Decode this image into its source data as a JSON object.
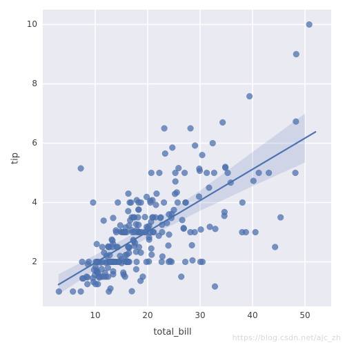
{
  "chart_data": {
    "type": "scatter",
    "xlabel": "total_bill",
    "ylabel": "tip",
    "xlim": [
      0,
      55
    ],
    "ylim": [
      0.5,
      10.5
    ],
    "xticks": [
      10,
      20,
      30,
      40,
      50
    ],
    "yticks": [
      2,
      4,
      6,
      8,
      10
    ],
    "regression": {
      "slope": 0.105,
      "intercept": 0.92
    },
    "ci_band": [
      {
        "x": 3,
        "lo": 0.9,
        "hi": 1.58
      },
      {
        "x": 10,
        "lo": 1.72,
        "hi": 2.23
      },
      {
        "x": 20,
        "lo": 2.82,
        "hi": 3.22
      },
      {
        "x": 30,
        "lo": 3.72,
        "hi": 4.4
      },
      {
        "x": 40,
        "lo": 4.55,
        "hi": 5.7
      },
      {
        "x": 50,
        "lo": 5.35,
        "hi": 7.0
      }
    ],
    "points": [
      [
        16.99,
        1.01
      ],
      [
        10.34,
        1.66
      ],
      [
        21.01,
        3.5
      ],
      [
        23.68,
        3.31
      ],
      [
        24.59,
        3.61
      ],
      [
        25.29,
        4.71
      ],
      [
        8.77,
        2.0
      ],
      [
        26.88,
        3.12
      ],
      [
        15.04,
        1.96
      ],
      [
        14.78,
        3.23
      ],
      [
        10.27,
        1.71
      ],
      [
        35.26,
        5.0
      ],
      [
        15.42,
        1.57
      ],
      [
        18.43,
        3.0
      ],
      [
        14.83,
        3.02
      ],
      [
        21.58,
        3.92
      ],
      [
        10.33,
        1.67
      ],
      [
        16.29,
        3.71
      ],
      [
        16.97,
        3.5
      ],
      [
        20.65,
        3.35
      ],
      [
        17.92,
        4.08
      ],
      [
        20.29,
        2.75
      ],
      [
        15.77,
        2.23
      ],
      [
        39.42,
        7.58
      ],
      [
        19.82,
        3.18
      ],
      [
        17.81,
        2.34
      ],
      [
        13.37,
        2.0
      ],
      [
        12.69,
        2.0
      ],
      [
        21.7,
        4.3
      ],
      [
        19.65,
        3.0
      ],
      [
        9.55,
        1.45
      ],
      [
        18.35,
        2.5
      ],
      [
        15.06,
        3.0
      ],
      [
        20.69,
        2.45
      ],
      [
        17.78,
        3.27
      ],
      [
        24.06,
        3.6
      ],
      [
        16.31,
        2.0
      ],
      [
        16.93,
        3.07
      ],
      [
        18.69,
        2.31
      ],
      [
        31.27,
        5.0
      ],
      [
        16.04,
        2.24
      ],
      [
        17.46,
        2.54
      ],
      [
        13.94,
        3.06
      ],
      [
        9.68,
        1.32
      ],
      [
        30.4,
        5.6
      ],
      [
        18.29,
        3.0
      ],
      [
        22.23,
        5.0
      ],
      [
        32.4,
        6.0
      ],
      [
        28.55,
        2.05
      ],
      [
        18.04,
        3.0
      ],
      [
        12.54,
        2.5
      ],
      [
        10.29,
        2.6
      ],
      [
        34.81,
        5.2
      ],
      [
        9.94,
        1.56
      ],
      [
        25.56,
        4.34
      ],
      [
        19.49,
        3.51
      ],
      [
        38.01,
        3.0
      ],
      [
        26.41,
        1.5
      ],
      [
        11.24,
        1.76
      ],
      [
        48.27,
        6.73
      ],
      [
        20.29,
        3.21
      ],
      [
        13.81,
        2.0
      ],
      [
        11.02,
        1.98
      ],
      [
        18.29,
        3.76
      ],
      [
        17.59,
        2.64
      ],
      [
        20.08,
        3.15
      ],
      [
        16.45,
        2.47
      ],
      [
        3.07,
        1.0
      ],
      [
        20.23,
        2.01
      ],
      [
        15.01,
        2.09
      ],
      [
        12.02,
        1.97
      ],
      [
        17.07,
        3.0
      ],
      [
        26.86,
        3.14
      ],
      [
        25.28,
        5.0
      ],
      [
        14.73,
        2.2
      ],
      [
        10.51,
        1.25
      ],
      [
        17.92,
        3.08
      ],
      [
        27.2,
        4.0
      ],
      [
        22.76,
        3.0
      ],
      [
        17.29,
        2.71
      ],
      [
        19.44,
        3.0
      ],
      [
        16.66,
        3.4
      ],
      [
        10.07,
        1.83
      ],
      [
        32.68,
        5.0
      ],
      [
        15.98,
        2.03
      ],
      [
        34.83,
        5.17
      ],
      [
        13.03,
        2.0
      ],
      [
        18.28,
        4.0
      ],
      [
        24.71,
        5.85
      ],
      [
        21.16,
        3.0
      ],
      [
        28.97,
        3.0
      ],
      [
        22.49,
        3.5
      ],
      [
        5.75,
        1.0
      ],
      [
        16.32,
        4.3
      ],
      [
        22.75,
        3.25
      ],
      [
        40.17,
        4.73
      ],
      [
        27.28,
        4.0
      ],
      [
        12.03,
        1.5
      ],
      [
        21.01,
        3.0
      ],
      [
        12.46,
        1.5
      ],
      [
        11.35,
        2.5
      ],
      [
        15.38,
        3.0
      ],
      [
        44.3,
        2.5
      ],
      [
        22.42,
        3.48
      ],
      [
        20.92,
        4.08
      ],
      [
        15.36,
        1.64
      ],
      [
        20.49,
        4.06
      ],
      [
        25.21,
        4.29
      ],
      [
        18.24,
        3.76
      ],
      [
        14.31,
        4.0
      ],
      [
        14.0,
        3.0
      ],
      [
        7.25,
        1.0
      ],
      [
        38.07,
        4.0
      ],
      [
        23.95,
        2.55
      ],
      [
        25.71,
        4.0
      ],
      [
        17.31,
        3.5
      ],
      [
        29.93,
        5.07
      ],
      [
        10.65,
        1.5
      ],
      [
        12.43,
        1.8
      ],
      [
        24.08,
        2.92
      ],
      [
        11.69,
        2.31
      ],
      [
        13.42,
        1.68
      ],
      [
        14.26,
        2.5
      ],
      [
        15.95,
        2.0
      ],
      [
        12.48,
        2.52
      ],
      [
        29.8,
        4.2
      ],
      [
        8.52,
        1.48
      ],
      [
        14.52,
        2.0
      ],
      [
        11.38,
        2.0
      ],
      [
        22.82,
        2.18
      ],
      [
        19.08,
        1.5
      ],
      [
        20.27,
        2.83
      ],
      [
        11.17,
        1.5
      ],
      [
        12.26,
        2.0
      ],
      [
        18.26,
        3.25
      ],
      [
        8.51,
        1.25
      ],
      [
        10.33,
        2.0
      ],
      [
        14.15,
        2.0
      ],
      [
        16.0,
        2.0
      ],
      [
        13.16,
        2.75
      ],
      [
        17.47,
        3.5
      ],
      [
        34.3,
        6.7
      ],
      [
        41.19,
        5.0
      ],
      [
        27.05,
        5.0
      ],
      [
        16.43,
        2.3
      ],
      [
        8.35,
        1.5
      ],
      [
        18.64,
        1.36
      ],
      [
        11.87,
        1.63
      ],
      [
        9.78,
        1.73
      ],
      [
        7.51,
        2.0
      ],
      [
        14.07,
        2.5
      ],
      [
        13.13,
        2.0
      ],
      [
        17.26,
        2.74
      ],
      [
        24.55,
        2.0
      ],
      [
        19.77,
        2.0
      ],
      [
        29.85,
        5.14
      ],
      [
        48.17,
        5.0
      ],
      [
        25.0,
        3.75
      ],
      [
        13.39,
        2.61
      ],
      [
        16.49,
        2.0
      ],
      [
        21.5,
        3.5
      ],
      [
        12.66,
        2.5
      ],
      [
        16.21,
        2.0
      ],
      [
        13.81,
        2.0
      ],
      [
        17.51,
        3.0
      ],
      [
        24.52,
        3.48
      ],
      [
        20.76,
        2.24
      ],
      [
        31.71,
        4.5
      ],
      [
        10.59,
        1.61
      ],
      [
        10.63,
        2.0
      ],
      [
        50.81,
        10.0
      ],
      [
        15.81,
        3.16
      ],
      [
        7.25,
        5.15
      ],
      [
        31.85,
        3.18
      ],
      [
        16.82,
        4.0
      ],
      [
        32.9,
        3.11
      ],
      [
        17.89,
        2.0
      ],
      [
        14.48,
        2.0
      ],
      [
        9.6,
        4.0
      ],
      [
        34.63,
        3.55
      ],
      [
        34.65,
        3.68
      ],
      [
        23.33,
        5.65
      ],
      [
        45.35,
        3.5
      ],
      [
        23.17,
        6.5
      ],
      [
        40.55,
        3.0
      ],
      [
        20.69,
        5.0
      ],
      [
        20.9,
        3.5
      ],
      [
        30.46,
        2.0
      ],
      [
        18.15,
        3.5
      ],
      [
        23.1,
        4.0
      ],
      [
        15.69,
        1.5
      ],
      [
        19.81,
        4.19
      ],
      [
        28.44,
        2.56
      ],
      [
        15.48,
        2.02
      ],
      [
        16.58,
        4.0
      ],
      [
        7.56,
        1.44
      ],
      [
        10.34,
        2.0
      ],
      [
        43.11,
        5.0
      ],
      [
        13.0,
        2.0
      ],
      [
        13.51,
        2.0
      ],
      [
        18.71,
        4.0
      ],
      [
        12.74,
        2.01
      ],
      [
        13.0,
        2.0
      ],
      [
        16.4,
        2.5
      ],
      [
        20.53,
        4.0
      ],
      [
        16.47,
        3.23
      ],
      [
        26.59,
        3.41
      ],
      [
        38.73,
        3.0
      ],
      [
        24.27,
        2.03
      ],
      [
        12.76,
        2.23
      ],
      [
        30.06,
        2.0
      ],
      [
        25.89,
        5.16
      ],
      [
        48.33,
        9.0
      ],
      [
        13.27,
        2.5
      ],
      [
        28.17,
        6.5
      ],
      [
        12.9,
        1.1
      ],
      [
        28.15,
        3.0
      ],
      [
        11.59,
        1.5
      ],
      [
        7.74,
        1.44
      ],
      [
        30.14,
        3.09
      ],
      [
        12.16,
        2.2
      ],
      [
        13.42,
        3.48
      ],
      [
        8.58,
        1.92
      ],
      [
        15.98,
        3.0
      ],
      [
        13.42,
        1.58
      ],
      [
        16.27,
        2.5
      ],
      [
        10.09,
        2.0
      ],
      [
        20.45,
        3.0
      ],
      [
        13.28,
        2.72
      ],
      [
        22.12,
        2.88
      ],
      [
        24.01,
        2.0
      ],
      [
        15.69,
        3.0
      ],
      [
        11.61,
        3.39
      ],
      [
        10.77,
        1.47
      ],
      [
        15.53,
        3.0
      ],
      [
        10.07,
        1.25
      ],
      [
        12.6,
        1.0
      ],
      [
        32.83,
        1.17
      ],
      [
        35.83,
        4.67
      ],
      [
        29.03,
        5.92
      ],
      [
        27.18,
        2.0
      ],
      [
        22.67,
        2.0
      ],
      [
        17.82,
        1.75
      ],
      [
        18.78,
        3.0
      ]
    ]
  },
  "point_style": {
    "fill": "#4c72b0",
    "opacity": 0.75,
    "radius": 4.4
  },
  "line_style": {
    "stroke": "#4c72b0",
    "width": 2.2
  },
  "band_style": {
    "fill": "#4c72b0",
    "opacity": 0.17
  },
  "watermark": "https://blog.csdn.net/ajc_zh"
}
